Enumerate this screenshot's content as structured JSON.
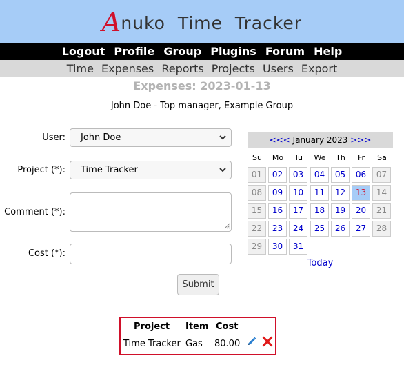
{
  "header": {
    "logo_first": "A",
    "logo_rest": "nuko  Time  Tracker"
  },
  "top_menu": [
    "Logout",
    "Profile",
    "Group",
    "Plugins",
    "Forum",
    "Help"
  ],
  "sub_menu": [
    "Time",
    "Expenses",
    "Reports",
    "Projects",
    "Users",
    "Export"
  ],
  "page_title": "Expenses: 2023-01-13",
  "user_info": "John Doe - Top manager, Example Group",
  "form": {
    "user_label": "User:",
    "user_value": "John Doe",
    "project_label": "Project (*):",
    "project_value": "Time Tracker",
    "comment_label": "Comment (*):",
    "comment_value": "",
    "cost_label": "Cost (*):",
    "cost_value": "",
    "submit_label": "Submit"
  },
  "calendar": {
    "prev": "<<<",
    "month": "January 2023",
    "next": ">>>",
    "weekdays": [
      "Su",
      "Mo",
      "Tu",
      "We",
      "Th",
      "Fr",
      "Sa"
    ],
    "weeks": [
      [
        "01",
        "02",
        "03",
        "04",
        "05",
        "06",
        "07"
      ],
      [
        "08",
        "09",
        "10",
        "11",
        "12",
        "13",
        "14"
      ],
      [
        "15",
        "16",
        "17",
        "18",
        "19",
        "20",
        "21"
      ],
      [
        "22",
        "23",
        "24",
        "25",
        "26",
        "27",
        "28"
      ],
      [
        "29",
        "30",
        "31"
      ]
    ],
    "selected": "13",
    "today_label": "Today"
  },
  "expenses_table": {
    "headers": [
      "Project",
      "Item",
      "Cost"
    ],
    "rows": [
      {
        "project": "Time Tracker",
        "item": "Gas",
        "cost": "80.00"
      }
    ]
  },
  "colors": {
    "header_bg": "#a6ccf7",
    "accent_red": "#d0102a",
    "link_blue": "#0000cc",
    "menu_bg": "#000000",
    "submenu_bg": "#d9d9d9"
  }
}
